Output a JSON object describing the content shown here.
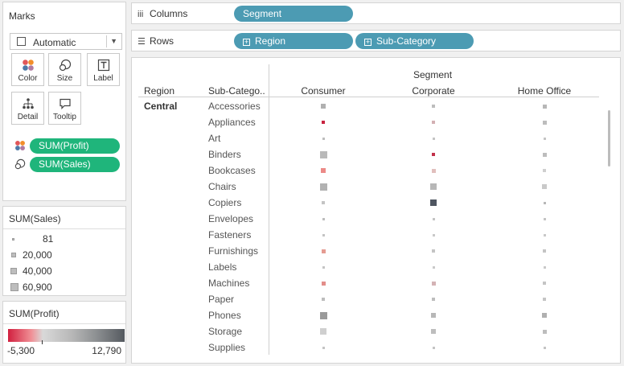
{
  "marks": {
    "title": "Marks",
    "mark_type": "Automatic",
    "cards": [
      {
        "name": "color",
        "label": "Color"
      },
      {
        "name": "size",
        "label": "Size"
      },
      {
        "name": "label",
        "label": "Label"
      },
      {
        "name": "detail",
        "label": "Detail"
      },
      {
        "name": "tooltip",
        "label": "Tooltip"
      }
    ],
    "fields": [
      {
        "label": "SUM(Profit)",
        "encoding": "color"
      },
      {
        "label": "SUM(Sales)",
        "encoding": "size"
      }
    ]
  },
  "size_legend": {
    "title": "SUM(Sales)",
    "items": [
      "81",
      "20,000",
      "40,000",
      "60,900"
    ]
  },
  "color_legend": {
    "title": "SUM(Profit)",
    "min": "-5,300",
    "max": "12,790",
    "colors": [
      "#d1203f",
      "#f09096",
      "#d9d9d9",
      "#b7b7b7",
      "#8e9193",
      "#555a60"
    ]
  },
  "shelves": {
    "columns_label": "Columns",
    "rows_label": "Rows",
    "columns": [
      "Segment"
    ],
    "rows": [
      "Region",
      "Sub-Category"
    ]
  },
  "view": {
    "segment_title": "Segment",
    "region_header": "Region",
    "subcategory_header": "Sub-Catego..",
    "segments": [
      "Consumer",
      "Corporate",
      "Home Office"
    ],
    "region": "Central",
    "rows": [
      {
        "sub": "Accessories",
        "marks": [
          {
            "size": 6,
            "color": "#b0b0b0"
          },
          {
            "size": 4,
            "color": "#bdbdbd"
          },
          {
            "size": 5,
            "color": "#b7b7b7"
          }
        ]
      },
      {
        "sub": "Appliances",
        "marks": [
          {
            "size": 4,
            "color": "#c8233f"
          },
          {
            "size": 4,
            "color": "#d3b0b3"
          },
          {
            "size": 5,
            "color": "#bdbdbd"
          }
        ]
      },
      {
        "sub": "Art",
        "marks": [
          {
            "size": 3,
            "color": "#bdbdbd"
          },
          {
            "size": 3,
            "color": "#c4c4c4"
          },
          {
            "size": 3,
            "color": "#c4c4c4"
          }
        ]
      },
      {
        "sub": "Binders",
        "marks": [
          {
            "size": 9,
            "color": "#b9b9b9"
          },
          {
            "size": 4,
            "color": "#c2304a"
          },
          {
            "size": 5,
            "color": "#bdbdbd"
          }
        ]
      },
      {
        "sub": "Bookcases",
        "marks": [
          {
            "size": 6,
            "color": "#ec8a87"
          },
          {
            "size": 5,
            "color": "#e1bfbd"
          },
          {
            "size": 4,
            "color": "#cfcfcf"
          }
        ]
      },
      {
        "sub": "Chairs",
        "marks": [
          {
            "size": 9,
            "color": "#b2b2b2"
          },
          {
            "size": 8,
            "color": "#b7b7b7"
          },
          {
            "size": 6,
            "color": "#c9c9c9"
          }
        ]
      },
      {
        "sub": "Copiers",
        "marks": [
          {
            "size": 4,
            "color": "#c4c4c4"
          },
          {
            "size": 8,
            "color": "#4f5661"
          },
          {
            "size": 3,
            "color": "#b8b8b8"
          }
        ]
      },
      {
        "sub": "Envelopes",
        "marks": [
          {
            "size": 3,
            "color": "#bdbdbd"
          },
          {
            "size": 3,
            "color": "#c4c4c4"
          },
          {
            "size": 3,
            "color": "#c4c4c4"
          }
        ]
      },
      {
        "sub": "Fasteners",
        "marks": [
          {
            "size": 3,
            "color": "#c4c4c4"
          },
          {
            "size": 3,
            "color": "#c9c9c9"
          },
          {
            "size": 3,
            "color": "#c9c9c9"
          }
        ]
      },
      {
        "sub": "Furnishings",
        "marks": [
          {
            "size": 5,
            "color": "#e59c92"
          },
          {
            "size": 4,
            "color": "#c4c4c4"
          },
          {
            "size": 4,
            "color": "#c4c4c4"
          }
        ]
      },
      {
        "sub": "Labels",
        "marks": [
          {
            "size": 3,
            "color": "#c4c4c4"
          },
          {
            "size": 3,
            "color": "#c9c9c9"
          },
          {
            "size": 3,
            "color": "#c9c9c9"
          }
        ]
      },
      {
        "sub": "Machines",
        "marks": [
          {
            "size": 5,
            "color": "#e38e8a"
          },
          {
            "size": 5,
            "color": "#d4b3b5"
          },
          {
            "size": 4,
            "color": "#c4c4c4"
          }
        ]
      },
      {
        "sub": "Paper",
        "marks": [
          {
            "size": 4,
            "color": "#bdbdbd"
          },
          {
            "size": 4,
            "color": "#bdbdbd"
          },
          {
            "size": 4,
            "color": "#c4c4c4"
          }
        ]
      },
      {
        "sub": "Phones",
        "marks": [
          {
            "size": 9,
            "color": "#9a9a9a"
          },
          {
            "size": 6,
            "color": "#b7b7b7"
          },
          {
            "size": 6,
            "color": "#b0b0b0"
          }
        ]
      },
      {
        "sub": "Storage",
        "marks": [
          {
            "size": 8,
            "color": "#cfcfcf"
          },
          {
            "size": 6,
            "color": "#bdbdbd"
          },
          {
            "size": 5,
            "color": "#bdbdbd"
          }
        ]
      },
      {
        "sub": "Supplies",
        "marks": [
          {
            "size": 3,
            "color": "#c4c4c4"
          },
          {
            "size": 3,
            "color": "#c4c4c4"
          },
          {
            "size": 3,
            "color": "#c4c4c4"
          }
        ]
      }
    ]
  }
}
